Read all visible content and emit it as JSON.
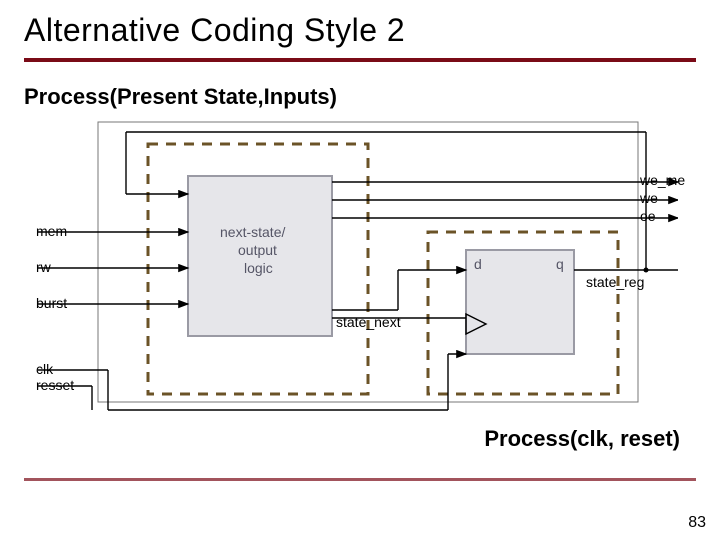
{
  "title": "Alternative Coding Style 2",
  "process_label_1": "Process(Present State,Inputs)",
  "process_label_2": "Process(clk, reset)",
  "page_number": "83",
  "diagram": {
    "inputs": {
      "mem": "mem",
      "rw": "rw",
      "burst": "burst",
      "clk": "clk",
      "resset": "resset"
    },
    "blocks": {
      "combo_label_1": "next-state/",
      "combo_label_2": "output",
      "combo_label_3": "logic",
      "reg_d": "d",
      "reg_q": "q"
    },
    "nets": {
      "state_next": "state_next",
      "state_reg": "state_reg"
    },
    "outputs": {
      "we_me": "we_me",
      "we": "we",
      "oe": "oe"
    }
  },
  "colors": {
    "accent": "#7a0b17",
    "dash": "#6b5327",
    "line": "#000"
  }
}
